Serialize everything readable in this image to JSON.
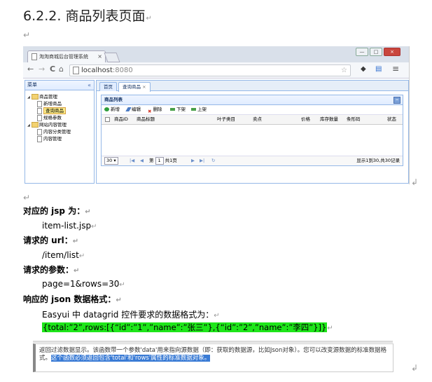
{
  "heading": {
    "number": "6.2.2.",
    "title": "商品列表页面"
  },
  "marks": {
    "para": "↵",
    "line": "↲"
  },
  "screenshot": {
    "browser": {
      "tab_title": "淘淘商城后台管理系统",
      "tab_close": "×",
      "url_host": "localhost",
      "url_port": ":8080",
      "nav": {
        "back": "←",
        "forward": "→",
        "reload": "C",
        "home": "⌂"
      },
      "window_buttons": {
        "min": "—",
        "max": "□",
        "close": "×"
      },
      "right_icons": {
        "star": "☆",
        "menu": "≡"
      }
    },
    "menu": {
      "title": "菜单",
      "collapse": "«",
      "tree": [
        {
          "label": "商品管理",
          "type": "folder"
        },
        {
          "label": "新增商品",
          "type": "file"
        },
        {
          "label": "查询商品",
          "type": "file",
          "selected": true
        },
        {
          "label": "规格参数",
          "type": "file"
        },
        {
          "label": "网站内容管理",
          "type": "folder"
        },
        {
          "label": "内容分类管理",
          "type": "file"
        },
        {
          "label": "内容管理",
          "type": "file"
        }
      ]
    },
    "tabs": [
      {
        "label": "首页"
      },
      {
        "label": "查询商品",
        "close": "×"
      }
    ],
    "panel": {
      "title": "商品列表",
      "toolbar": [
        {
          "label": "新增",
          "color": "#2e9e3c"
        },
        {
          "label": "编辑",
          "color": "#4b7bc4"
        },
        {
          "label": "删除",
          "color": "#d33a2c"
        },
        {
          "label": "下架",
          "color": "#4aa04a"
        },
        {
          "label": "上架",
          "color": "#4aa04a"
        }
      ],
      "columns": [
        "商品ID",
        "商品标题",
        "叶子类目",
        "卖点",
        "价格",
        "库存数量",
        "条形码",
        "状态"
      ],
      "pager": {
        "page_size": "30",
        "page_prefix": "第",
        "page_value": "1",
        "page_suffix": "共1页",
        "summary": "显示1到30,共30记录"
      }
    }
  },
  "body": {
    "jsp_label": "对应的 jsp 为：",
    "jsp_value": "item-list.jsp",
    "url_label": "请求的 url：",
    "url_value": "/item/list",
    "param_label": "请求的参数：",
    "param_value": "page=1&rows=30",
    "json_label": "响应的 json 数据格式：",
    "json_desc": "Easyui 中 datagrid 控件要求的数据格式为：",
    "json_example": "{total:”2”,rows:[{“id”:”1”,”name”:”张三”},{“id”:”2”,”name”:”李四”}]}"
  },
  "doc_excerpt": {
    "text": "返回过滤数据显示。该函数带一个参数'data'用来指向源数据（即：获取的数据源，比如Json对象）。您可以改变源数据的标准数据格式。",
    "highlight": "这个函数必须返回包含'total'和'rows'属性的标准数据对象。"
  },
  "colors": {
    "highlight_green": "#1ee61a",
    "selection_blue": "#3a7bd5",
    "easyui_border": "#95b8e7"
  }
}
